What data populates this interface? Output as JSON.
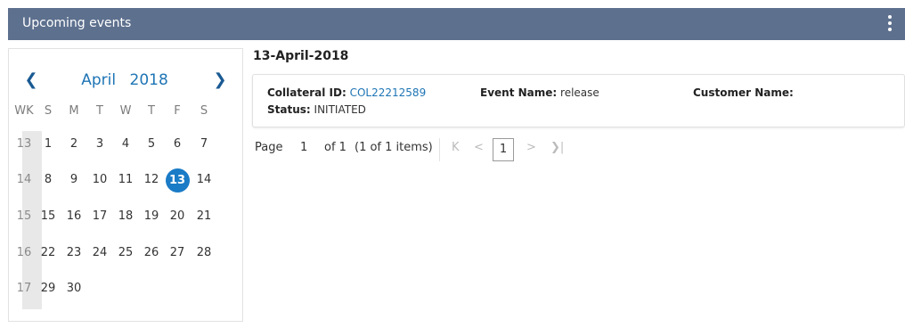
{
  "header": {
    "title": "Upcoming events",
    "menu_icon": "kebab-menu-icon"
  },
  "calendar": {
    "month": "April",
    "year": "2018",
    "prev_icon": "chevron-left-icon",
    "next_icon": "chevron-right-icon",
    "week_label": "WK",
    "weekdays": [
      "S",
      "M",
      "T",
      "W",
      "T",
      "F",
      "S"
    ],
    "weeks": [
      {
        "wk": "13",
        "days": [
          "1",
          "2",
          "3",
          "4",
          "5",
          "6",
          "7"
        ]
      },
      {
        "wk": "14",
        "days": [
          "8",
          "9",
          "10",
          "11",
          "12",
          "13",
          "14"
        ]
      },
      {
        "wk": "15",
        "days": [
          "15",
          "16",
          "17",
          "18",
          "19",
          "20",
          "21"
        ]
      },
      {
        "wk": "16",
        "days": [
          "22",
          "23",
          "24",
          "25",
          "26",
          "27",
          "28"
        ]
      },
      {
        "wk": "17",
        "days": [
          "29",
          "30",
          "",
          "",
          "",
          "",
          ""
        ]
      }
    ],
    "selected_day": "13",
    "selected_color": "#1a7bc6"
  },
  "events": {
    "date_heading": "13-April-2018",
    "items": [
      {
        "collateral_label": "Collateral ID:",
        "collateral_id": "COL22212589",
        "event_label": "Event Name:",
        "event_name": "release",
        "customer_label": "Customer Name:",
        "customer_name": "",
        "status_label": "Status:",
        "status": "INITIATED"
      }
    ]
  },
  "pager": {
    "page_label": "Page",
    "page_value": "1",
    "of_label": "of 1",
    "items_label": "(1 of 1 items)",
    "current": "1",
    "first_icon": "first-page-icon",
    "prev_icon": "prev-page-icon",
    "next_icon": "next-page-icon",
    "last_icon": "last-page-icon"
  }
}
